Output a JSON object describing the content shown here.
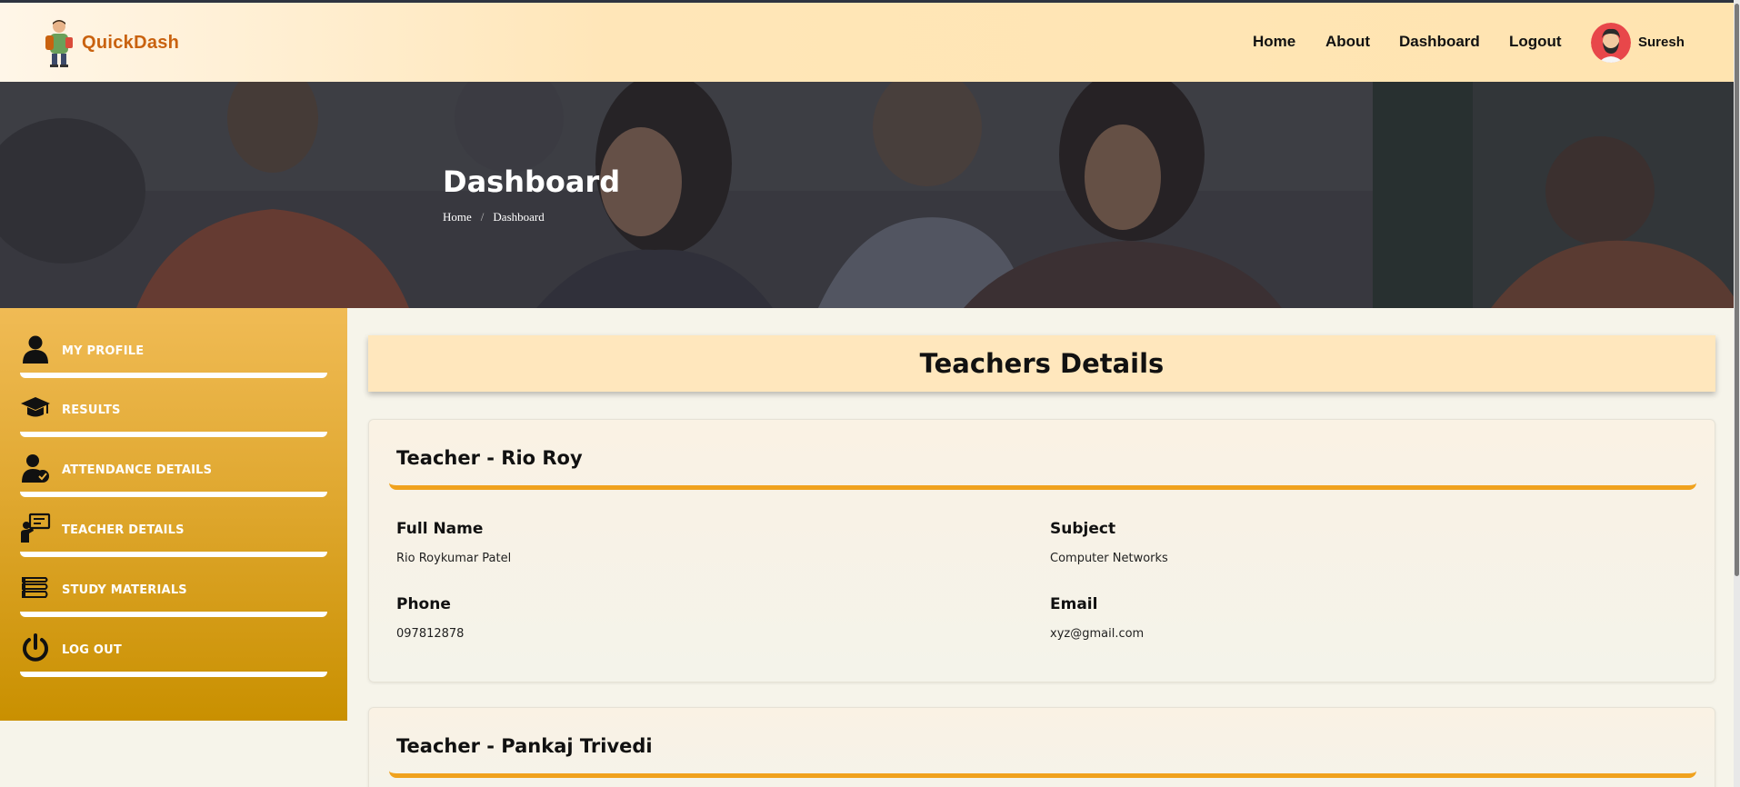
{
  "brand": {
    "name": "QuickDash"
  },
  "nav": {
    "links": [
      "Home",
      "About",
      "Dashboard",
      "Logout"
    ],
    "user_name": "Suresh"
  },
  "hero": {
    "title": "Dashboard",
    "breadcrumb": [
      "Home",
      "Dashboard"
    ],
    "breadcrumb_separator": "/"
  },
  "sidebar": {
    "items": [
      {
        "label": "MY PROFILE",
        "icon": "user-icon"
      },
      {
        "label": "RESULTS",
        "icon": "graduation-cap-icon"
      },
      {
        "label": "ATTENDANCE DETAILS",
        "icon": "user-check-icon"
      },
      {
        "label": "TEACHER DETAILS",
        "icon": "teacher-board-icon"
      },
      {
        "label": "STUDY MATERIALS",
        "icon": "books-icon"
      },
      {
        "label": "LOG OUT",
        "icon": "power-icon"
      }
    ]
  },
  "main": {
    "title": "Teachers Details",
    "teachers": [
      {
        "heading": "Teacher - Rio Roy",
        "full_name_label": "Full Name",
        "full_name": "Rio Roykumar Patel",
        "subject_label": "Subject",
        "subject": "Computer Networks",
        "phone_label": "Phone",
        "phone": "097812878",
        "email_label": "Email",
        "email": "xyz@gmail.com"
      },
      {
        "heading": "Teacher - Pankaj Trivedi"
      }
    ]
  },
  "colors": {
    "accent": "#f0a21d",
    "brand": "#c9620f",
    "sidebar_top": "#f0bb55",
    "sidebar_bottom": "#c99000",
    "header_bg": "#ffe7bd"
  }
}
